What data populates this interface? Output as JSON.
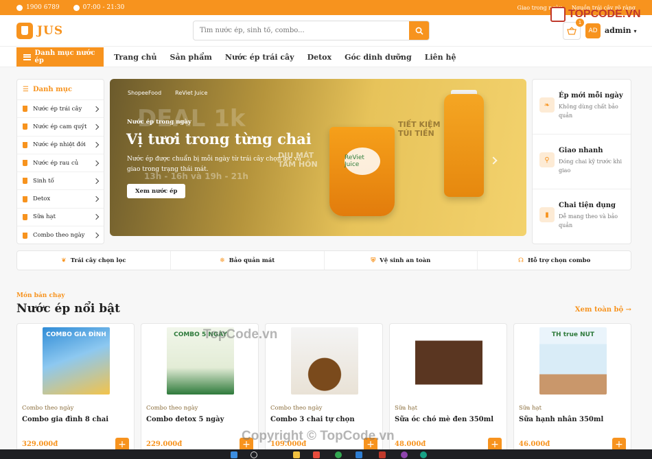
{
  "topbar": {
    "phone": "1900 6789",
    "hours": "07:00 - 21:30",
    "delivery": "Giao trong ngày",
    "source": "Nguồn trái cây rõ ràng"
  },
  "header": {
    "logo": "JUS",
    "search_placeholder": "Tìm nước ép, sinh tố, combo...",
    "cart_count": "1",
    "avatar": "AD",
    "user": "admin"
  },
  "nav": {
    "category_button": "Danh mục nước ép",
    "items": [
      "Trang chủ",
      "Sản phẩm",
      "Nước ép trái cây",
      "Detox",
      "Góc dinh dưỡng",
      "Liên hệ"
    ]
  },
  "sidebar": {
    "title": "Danh mục",
    "items": [
      "Nước ép trái cây",
      "Nước ép cam quýt",
      "Nước ép nhiệt đới",
      "Nước ép rau củ",
      "Sinh tố",
      "Detox",
      "Sữa hạt",
      "Combo theo ngày"
    ]
  },
  "hero": {
    "brands": [
      "ShopeeFood",
      "ReViet Juice"
    ],
    "tag": "Nước ép trong ngày",
    "title": "Vị tươi trong từng chai",
    "desc": "Nước ép được chuẩn bị mỗi ngày từ trái cây chọn lọc và giao trong trạng thái mát.",
    "button": "Xem nước ép",
    "art_text": [
      "DEAL 1k",
      "TIẾT KIỆM TÚI TIỀN",
      "DỊU MÁT TÂM HỒN",
      "13h - 16h và 19h - 21h",
      "ReViet Juice"
    ]
  },
  "features": [
    {
      "icon": "leaf-icon",
      "title": "Ép mới mỗi ngày",
      "desc": "Không dùng chất bảo quản"
    },
    {
      "icon": "motorbike-icon",
      "title": "Giao nhanh",
      "desc": "Đóng chai kỹ trước khi giao"
    },
    {
      "icon": "bottle-icon",
      "title": "Chai tiện dụng",
      "desc": "Dễ mang theo và bảo quản"
    }
  ],
  "strip": [
    {
      "icon": "sprout-icon",
      "label": "Trái cây chọn lọc"
    },
    {
      "icon": "snowflake-icon",
      "label": "Bảo quản mát"
    },
    {
      "icon": "shield-icon",
      "label": "Vệ sinh an toàn"
    },
    {
      "icon": "headset-icon",
      "label": "Hỗ trợ chọn combo"
    }
  ],
  "section": {
    "tag": "Món bán chạy",
    "title": "Nước ép nổi bật",
    "see_all": "Xem toàn bộ →"
  },
  "products": [
    {
      "category": "Combo theo ngày",
      "name": "Combo gia đình 8 chai",
      "price": "329.000đ",
      "thumb_text": "COMBO GIA ĐÌNH"
    },
    {
      "category": "Combo theo ngày",
      "name": "Combo detox 5 ngày",
      "price": "229.000đ",
      "thumb_text": "COMBO 5 NGÀY"
    },
    {
      "category": "Combo theo ngày",
      "name": "Combo 3 chai tự chọn",
      "price": "109.000đ",
      "thumb_text": ""
    },
    {
      "category": "Sữa hạt",
      "name": "Sữa óc chó mè đen 350ml",
      "price": "48.000đ",
      "thumb_text": ""
    },
    {
      "category": "Sữa hạt",
      "name": "Sữa hạnh nhân 350ml",
      "price": "46.000đ",
      "thumb_text": "TH true NUT"
    }
  ],
  "watermarks": {
    "logo": "TOPCODE.VN",
    "center": "TopCode.vn",
    "copyright": "Copyright © TopCode.vn"
  },
  "colors": {
    "accent": "#f7931e",
    "dark_text": "#222222"
  }
}
